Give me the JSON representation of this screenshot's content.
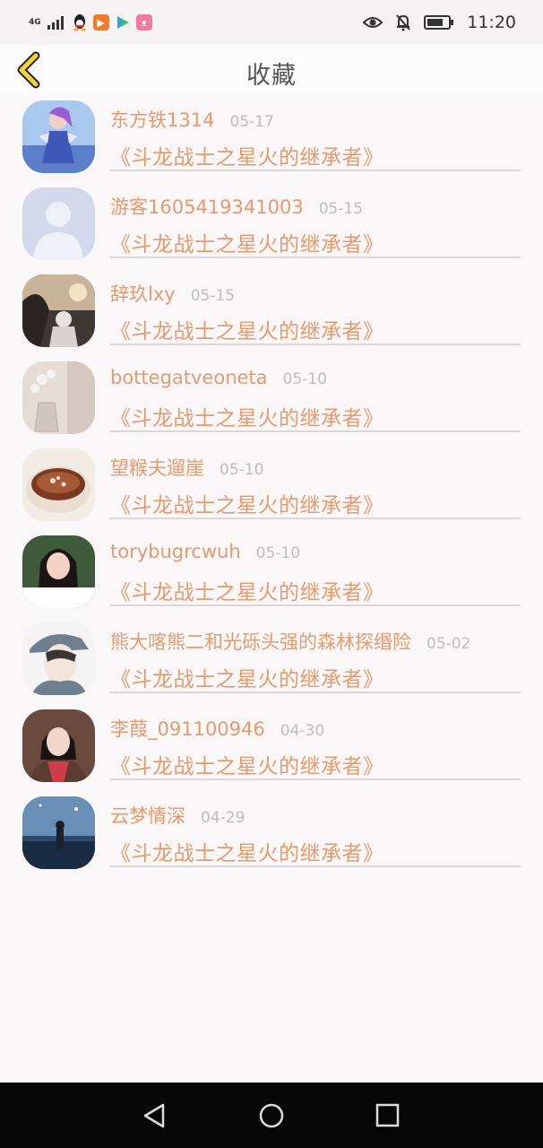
{
  "status_bar": {
    "network": "4G",
    "time": "11:20",
    "icons": [
      "signal-icon",
      "qq-icon",
      "video-app-icon",
      "play-app-icon",
      "cat-app-icon",
      "eye-icon",
      "mute-bell-icon",
      "battery-icon"
    ]
  },
  "header": {
    "title": "收藏",
    "back_icon": "back-chevron-icon",
    "accent": "#f2d23a"
  },
  "colors": {
    "name": "#e79a6c",
    "date": "#bdbdbd",
    "divider": "#d9d7d8",
    "background": "#f9f7f8"
  },
  "favorites": [
    {
      "name": "东方铁1314",
      "date": "05-17",
      "title": "《斗龙战士之星火的继承者》"
    },
    {
      "name": "游客1605419341003",
      "date": "05-15",
      "title": "《斗龙战士之星火的继承者》"
    },
    {
      "name": "辞玖lxy",
      "date": "05-15",
      "title": "《斗龙战士之星火的继承者》"
    },
    {
      "name": "bottegatveoneta",
      "date": "05-10",
      "title": "《斗龙战士之星火的继承者》"
    },
    {
      "name": "望糇夫遛崖",
      "date": "05-10",
      "title": "《斗龙战士之星火的继承者》"
    },
    {
      "name": "torybugrcwuh",
      "date": "05-10",
      "title": "《斗龙战士之星火的继承者》"
    },
    {
      "name": "熊大喀熊二和光砾头强的森林探缗险",
      "date": "05-02",
      "title": "《斗龙战士之星火的继承者》"
    },
    {
      "name": "李葭_091100946",
      "date": "04-30",
      "title": "《斗龙战士之星火的继承者》"
    },
    {
      "name": "云梦情深",
      "date": "04-29",
      "title": "《斗龙战士之星火的继承者》"
    }
  ],
  "nav_bar": {
    "icons": [
      "back-triangle-icon",
      "home-circle-icon",
      "recents-square-icon"
    ]
  }
}
